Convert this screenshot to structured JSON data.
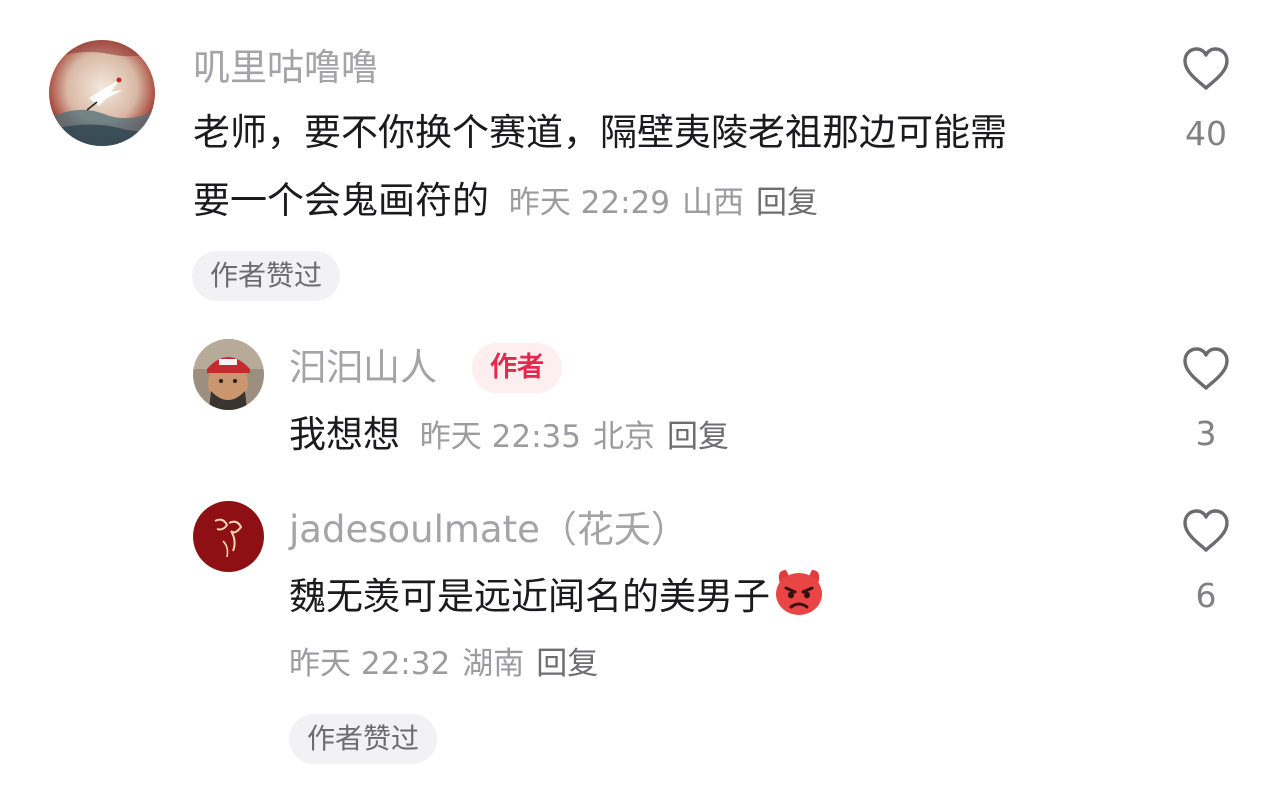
{
  "colors": {
    "username": "#a3a3a8",
    "body_text": "#1b1b1f",
    "meta": "#9b9ba0",
    "author_tag": "#e5284b",
    "chip_bg": "#f2f2f4"
  },
  "comments": [
    {
      "username": "叽里咕噜噜",
      "text_line1": "老师，要不你换个赛道，隔壁夷陵老祖那边可能需",
      "text_line2": "要一个会鬼画符的",
      "time": "昨天 22:29",
      "location": "山西",
      "reply_label": "回复",
      "likes": "40",
      "liked_by_author": "作者赞过",
      "avatar_icon": "crane-painting-avatar",
      "like_icon": "heart-outline-icon"
    },
    {
      "username": "汩汩山人",
      "author_tag": "作者",
      "text": "我想想",
      "time": "昨天 22:35",
      "location": "北京",
      "reply_label": "回复",
      "likes": "3",
      "avatar_icon": "man-red-cap-avatar",
      "like_icon": "heart-outline-icon"
    },
    {
      "username": "jadesoulmate（花夭）",
      "text": "魏无羡可是远近闻名的美男子",
      "emoji": "angry-face-emoji",
      "time": "昨天 22:32",
      "location": "湖南",
      "reply_label": "回复",
      "likes": "6",
      "liked_by_author": "作者赞过",
      "avatar_icon": "red-calligraphy-avatar",
      "like_icon": "heart-outline-icon"
    }
  ]
}
